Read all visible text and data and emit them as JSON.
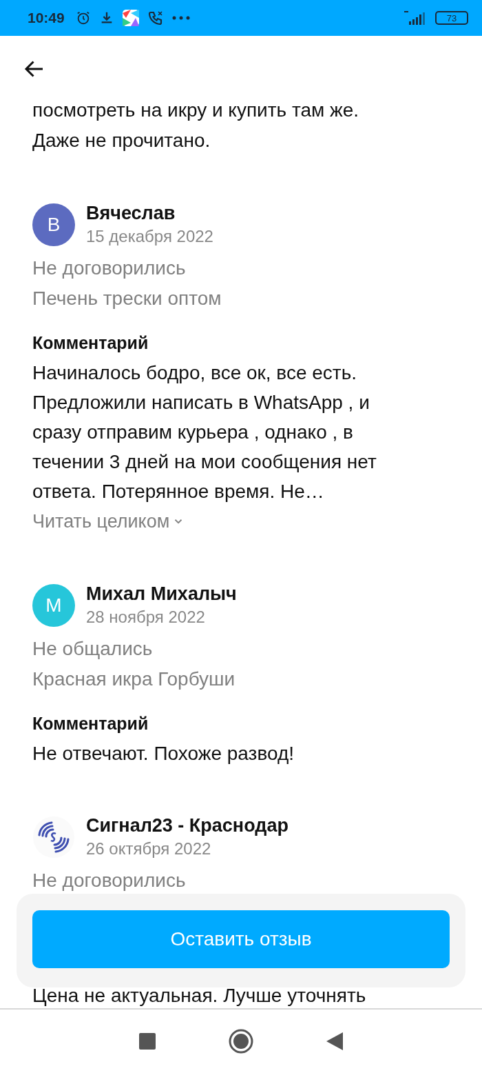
{
  "status_bar": {
    "time": "10:49",
    "battery": "73"
  },
  "intro_lines": [
    "посмотреть на икру и купить там же.",
    "Даже не прочитано."
  ],
  "reviews": [
    {
      "author": "Вячеслав",
      "date": "15 декабря 2022",
      "avatar": {
        "kind": "letter",
        "letter": "В",
        "color": "#5c6bc0"
      },
      "status": "Не договорились",
      "product": "Печень трески оптом",
      "comment_heading": "Комментарий",
      "comment": "Начиналось бодро, все ок, все есть. Предложили написать в WhatsApp , и сразу отправим курьера , однако , в течении 3 дней на мои сообщения нет ответа. Потерянное время. Не…",
      "read_more": "Читать целиком"
    },
    {
      "author": "Михал Михалыч",
      "date": "28 ноября 2022",
      "avatar": {
        "kind": "letter",
        "letter": "М",
        "color": "#26c6da"
      },
      "status": "Не общались",
      "product": "Красная икра Горбуши",
      "comment_heading": "Комментарий",
      "comment": "Не отвечают. Похоже развод!"
    },
    {
      "author": "Сигнал23 - Краснодар",
      "date": "26 октября 2022",
      "avatar": {
        "kind": "logo"
      },
      "status": "Не договорились",
      "comment": "Цена не актуальная. Лучше уточнять"
    }
  ],
  "action_button": "Оставить отзыв"
}
